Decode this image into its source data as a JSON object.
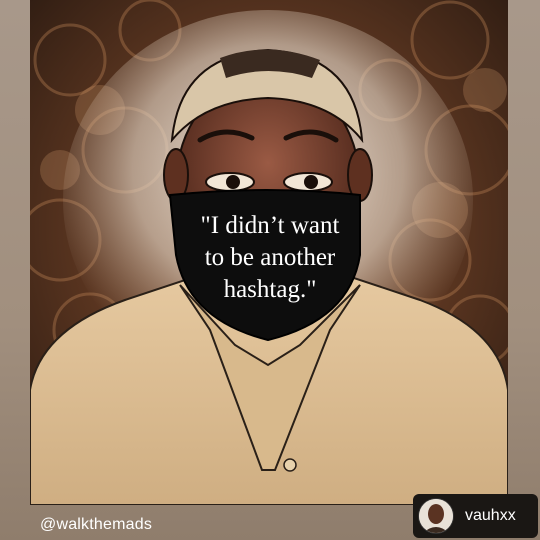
{
  "post": {
    "mask_quote_line1": "\"I didn’t want",
    "mask_quote_line2": "to be another",
    "mask_quote_line3": "hashtag.\"",
    "artist_credit": "@walkthemads"
  },
  "repost_badge": {
    "username": "vauhxx"
  },
  "colors": {
    "background": "#a8988a",
    "mask": "#0d0d0d",
    "shirt": "#d9b98f",
    "skin": "#6b3a2a",
    "badge": "#1a1714"
  }
}
